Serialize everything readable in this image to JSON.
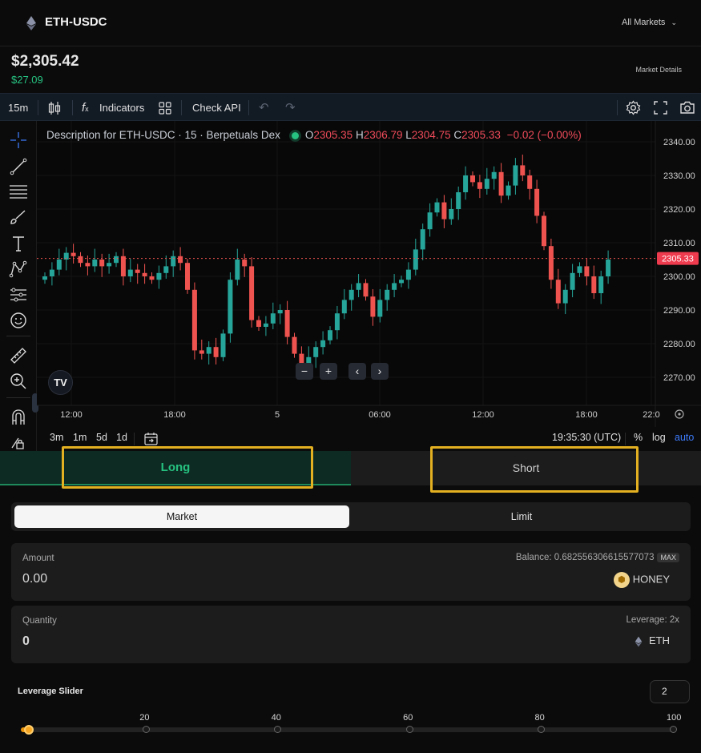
{
  "header": {
    "pair": "ETH-USDC",
    "all_markets": "All Markets",
    "price": "$2,305.42",
    "change": "$27.09",
    "market_details": "Market Details"
  },
  "toolbar": {
    "interval": "15m",
    "indicators": "Indicators",
    "check_api": "Check API"
  },
  "chart": {
    "legend_title": "Description for ETH-USDC · 15 · Berpetuals Dex",
    "ohlc": {
      "o_label": "O",
      "o": "2305.35",
      "h_label": "H",
      "h": "2306.79",
      "l_label": "L",
      "l": "2304.75",
      "c_label": "C",
      "c": "2305.33",
      "chg": "−0.02 (−0.00%)"
    },
    "current_price_label": "2305.33",
    "zoom_minus": "−",
    "zoom_plus": "+",
    "logo_text": "TV",
    "bottom": {
      "ranges": [
        "3m",
        "1m",
        "5d",
        "1d"
      ],
      "time": "19:35:30 (UTC)",
      "percent": "%",
      "log": "log",
      "auto": "auto"
    },
    "colors": {
      "up": "#26a69a",
      "down": "#ef5350",
      "accent": "#2962ff"
    }
  },
  "chart_data": {
    "type": "candlestick",
    "title": "Description for ETH-USDC · 15 · Berpetuals Dex",
    "x_ticks": [
      "12:00",
      "18:00",
      "5",
      "06:00",
      "12:00",
      "18:00",
      "22:0"
    ],
    "y_ticks": [
      2340,
      2330,
      2320,
      2310,
      2300,
      2290,
      2280,
      2270
    ],
    "ylim": [
      2265,
      2345
    ],
    "last_price": 2305.33,
    "closes": [
      2300,
      2302,
      2305,
      2307,
      2306,
      2304,
      2303,
      2305,
      2303,
      2304,
      2306,
      2300,
      2302,
      2301,
      2300,
      2299,
      2301,
      2303,
      2306,
      2304,
      2296,
      2278,
      2277,
      2279,
      2276,
      2283,
      2299,
      2305,
      2303,
      2287,
      2285,
      2286,
      2289,
      2290,
      2282,
      2277,
      2273,
      2276,
      2279,
      2281,
      2284,
      2289,
      2293,
      2296,
      2298,
      2294,
      2288,
      2293,
      2296,
      2298,
      2299,
      2302,
      2308,
      2314,
      2319,
      2322,
      2317,
      2320,
      2325,
      2330,
      2328,
      2326,
      2329,
      2331,
      2324,
      2327,
      2333,
      2330,
      2326,
      2318,
      2309,
      2299,
      2292,
      2296,
      2301,
      2303,
      2300,
      2295,
      2300,
      2305
    ]
  },
  "trade": {
    "long": "Long",
    "short": "Short",
    "market": "Market",
    "limit": "Limit",
    "amount_label": "Amount",
    "amount_value": "0.00",
    "balance": "Balance: 0.682556306615577073",
    "max": "MAX",
    "amount_token": "HONEY",
    "quantity_label": "Quantity",
    "quantity_value": "0",
    "leverage_text": "Leverage: 2x",
    "quantity_token": "ETH"
  },
  "leverage": {
    "label": "Leverage Slider",
    "value": "2",
    "min": 1,
    "max": 100,
    "ticks": [
      "20",
      "40",
      "60",
      "80",
      "100"
    ]
  }
}
